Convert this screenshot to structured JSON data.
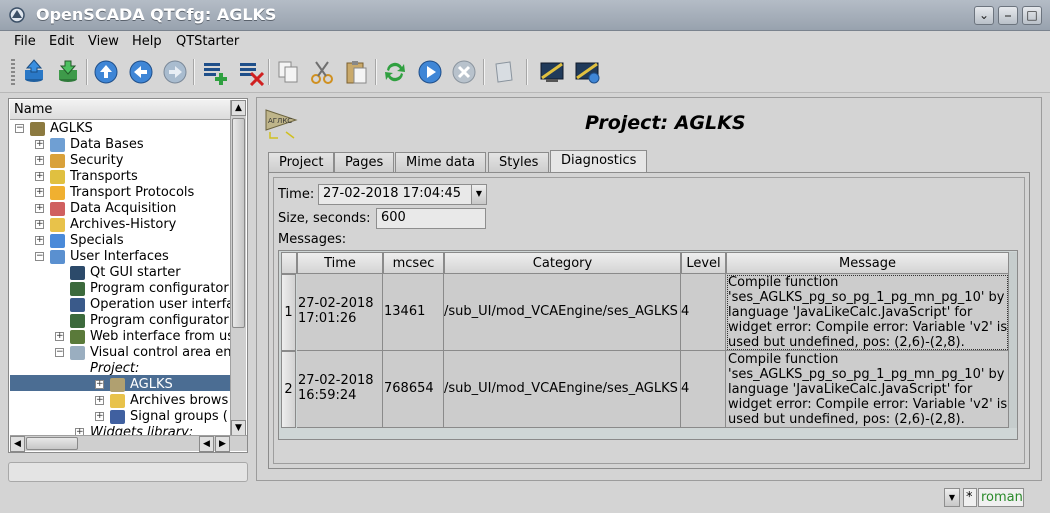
{
  "window": {
    "title": "OpenSCADA QTCfg: AGLKS",
    "buttons": [
      "⌄",
      "⎯",
      "□",
      "✕"
    ]
  },
  "menu": {
    "items": [
      "File",
      "Edit",
      "View",
      "Help",
      "QTStarter"
    ]
  },
  "toolbar": {
    "icons": [
      "db-load-icon",
      "db-save-icon",
      "up-icon",
      "back-icon",
      "forward-icon",
      "add-item-icon",
      "delete-item-icon",
      "copy-icon",
      "cut-icon",
      "paste-icon",
      "refresh-icon",
      "start-icon",
      "stop-icon",
      "info-icon",
      "vision-icon",
      "vision-run-icon"
    ]
  },
  "tree": {
    "header": "Name",
    "nodes": [
      {
        "label": "AGLKS",
        "level": 0,
        "expander": "−",
        "icon": "station-icon",
        "color": "#8c7a40"
      },
      {
        "label": "Data Bases",
        "level": 1,
        "expander": "+",
        "icon": "database-icon",
        "color": "#6f9fd3"
      },
      {
        "label": "Security",
        "level": 1,
        "expander": "+",
        "icon": "security-icon",
        "color": "#d9a13a"
      },
      {
        "label": "Transports",
        "level": 1,
        "expander": "+",
        "icon": "transports-icon",
        "color": "#e0c040"
      },
      {
        "label": "Transport Protocols",
        "level": 1,
        "expander": "+",
        "icon": "protocols-icon",
        "color": "#f0b030"
      },
      {
        "label": "Data Acquisition",
        "level": 1,
        "expander": "+",
        "icon": "acquisition-icon",
        "color": "#d06060"
      },
      {
        "label": "Archives-History",
        "level": 1,
        "expander": "+",
        "icon": "archives-icon",
        "color": "#e8c24a"
      },
      {
        "label": "Specials",
        "level": 1,
        "expander": "+",
        "icon": "specials-icon",
        "color": "#4a8ad9"
      },
      {
        "label": "User Interfaces",
        "level": 1,
        "expander": "−",
        "icon": "ui-icon",
        "color": "#5a90d0"
      },
      {
        "label": "Qt GUI starter",
        "level": 2,
        "expander": "",
        "icon": "qt-starter-icon",
        "color": "#2c4a6a"
      },
      {
        "label": "Program configurator",
        "level": 2,
        "expander": "",
        "icon": "configurator-icon",
        "color": "#3c6a3c"
      },
      {
        "label": "Operation user interfa",
        "level": 2,
        "expander": "",
        "icon": "vision-icon",
        "color": "#3a5a8a"
      },
      {
        "label": "Program configurator",
        "level": 2,
        "expander": "",
        "icon": "configurator-icon",
        "color": "#3c6a3c"
      },
      {
        "label": "Web interface from us",
        "level": 2,
        "expander": "+",
        "icon": "web-icon",
        "color": "#5a7a3a"
      },
      {
        "label": "Visual control area en",
        "level": 2,
        "expander": "−",
        "icon": "vca-icon",
        "color": "#9aaec0"
      },
      {
        "label": "Project:",
        "level": 3,
        "expander": "",
        "icon": "",
        "italic": true
      },
      {
        "label": "AGLKS",
        "level": 4,
        "expander": "+",
        "icon": "project-icon",
        "color": "#b0a070",
        "selected": true
      },
      {
        "label": "Archives brows",
        "level": 4,
        "expander": "+",
        "icon": "archive-project-icon",
        "color": "#e8c24a"
      },
      {
        "label": "Signal groups (",
        "level": 4,
        "expander": "+",
        "icon": "signals-icon",
        "color": "#4060a0"
      },
      {
        "label": "Widgets library:",
        "level": 3,
        "expander": "+",
        "icon": "",
        "italic": true
      }
    ]
  },
  "main": {
    "title": "Project: AGLKS",
    "icon_text": "АГЛКС",
    "tabs": [
      "Project",
      "Pages",
      "Mime data",
      "Styles",
      "Diagnostics"
    ],
    "active_tab": "Diagnostics",
    "time_label": "Time:",
    "time_value": "27-02-2018 17:04:45",
    "size_label": "Size, seconds:",
    "size_value": "600",
    "messages_label": "Messages:",
    "table": {
      "columns": [
        "Time",
        "mcsec",
        "Category",
        "Level",
        "Message"
      ],
      "rows": [
        {
          "num": "1",
          "time": "27-02-2018 17:01:26",
          "mcsec": "13461",
          "category": "/sub_UI/mod_VCAEngine/ses_AGLKS",
          "level": "4",
          "message": "Compile function 'ses_AGLKS_pg_so_pg_1_pg_mn_pg_10' by language 'JavaLikeCalc.JavaScript' for widget error: Compile error: Variable 'v2' is used but undefined, pos: (2,6)-(2,8)."
        },
        {
          "num": "2",
          "time": "27-02-2018 16:59:24",
          "mcsec": "768654",
          "category": "/sub_UI/mod_VCAEngine/ses_AGLKS",
          "level": "4",
          "message": "Compile function 'ses_AGLKS_pg_so_pg_1_pg_mn_pg_10' by language 'JavaLikeCalc.JavaScript' for widget error: Compile error: Variable 'v2' is used but undefined, pos: (2,6)-(2,8)."
        }
      ]
    }
  },
  "statusbar": {
    "user": "roman",
    "modified_mark": "*",
    "user_color": "#2a8a2a"
  },
  "colors": {
    "selection": "#4b6d93",
    "titlebar": "#a6afba"
  }
}
